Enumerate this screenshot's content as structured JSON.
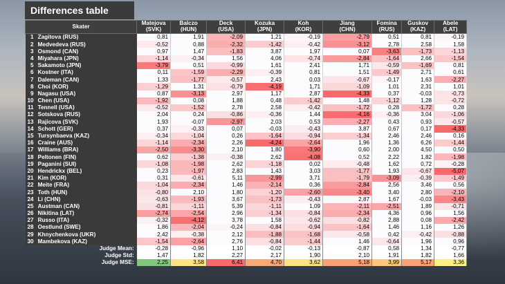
{
  "title": "Differences table",
  "chart_data": {
    "type": "table",
    "skater_header": "Skater",
    "judges": [
      "Matejova (SVK)",
      "Balczo (HUN)",
      "Deck (USA)",
      "Kozuka (JPN)",
      "Koh (KOR)",
      "Jiang (CHN)",
      "Fomina (RUS)",
      "Guskov (KAZ)",
      "Abele (LAT)"
    ],
    "rows": [
      {
        "rank": "1",
        "skater": "Zagitova (RUS)",
        "values": [
          "0,81",
          "1,91",
          "-2,09",
          "1,21",
          "-0,19",
          "-2,79",
          "0,51",
          "0,81",
          "-0,19"
        ]
      },
      {
        "rank": "2",
        "skater": "Medvedeva (RUS)",
        "values": [
          "-0,52",
          "0,88",
          "-2,32",
          "-1,42",
          "-0,42",
          "-3,12",
          "2,78",
          "2,58",
          "1,58"
        ]
      },
      {
        "rank": "3",
        "skater": "Osmond (CAN)",
        "values": [
          "0,97",
          "1,47",
          "-1,83",
          "3,87",
          "1,97",
          "0,07",
          "-3,63",
          "-1,73",
          "-1,13"
        ]
      },
      {
        "rank": "4",
        "skater": "Miyahara (JPN)",
        "values": [
          "-1,14",
          "-0,34",
          "1,56",
          "4,06",
          "-0,74",
          "-2,84",
          "-1,64",
          "2,66",
          "-1,54"
        ]
      },
      {
        "rank": "5",
        "skater": "Sakamoto (JPN)",
        "values": [
          "-3,79",
          "0,51",
          "-0,99",
          "1,61",
          "2,41",
          "1,71",
          "-0,59",
          "-1,69",
          "0,81"
        ]
      },
      {
        "rank": "6",
        "skater": "Kostner (ITA)",
        "values": [
          "0,11",
          "-1,59",
          "-2,29",
          "-0,39",
          "0,81",
          "1,51",
          "-1,49",
          "2,71",
          "0,61"
        ]
      },
      {
        "rank": "7",
        "skater": "Daleman (CAN)",
        "values": [
          "1,33",
          "-1,77",
          "-0,57",
          "2,43",
          "0,03",
          "-0,67",
          "-0,17",
          "1,63",
          "-2,27"
        ]
      },
      {
        "rank": "8",
        "skater": "Choi (KOR)",
        "values": [
          "-1,29",
          "1,31",
          "-0,79",
          "-4,19",
          "1,71",
          "-1,09",
          "1,01",
          "2,31",
          "1,01"
        ]
      },
      {
        "rank": "9",
        "skater": "Nagasu (USA)",
        "values": [
          "0,87",
          "-3,13",
          "2,97",
          "1,17",
          "2,87",
          "-4,33",
          "0,37",
          "-0,03",
          "-0,73"
        ]
      },
      {
        "rank": "10",
        "skater": "Chen (USA)",
        "values": [
          "-1,92",
          "0,08",
          "1,88",
          "0,48",
          "-1,42",
          "1,48",
          "-1,12",
          "1,28",
          "-0,72"
        ]
      },
      {
        "rank": "11",
        "skater": "Tennell (USA)",
        "values": [
          "-0,52",
          "-1,52",
          "2,78",
          "2,58",
          "-0,42",
          "-1,72",
          "0,28",
          "-1,72",
          "0,28"
        ]
      },
      {
        "rank": "12",
        "skater": "Sotskova (RUS)",
        "values": [
          "2,04",
          "0,24",
          "-0,86",
          "-0,36",
          "1,44",
          "-4,16",
          "-0,36",
          "3,04",
          "-1,06"
        ]
      },
      {
        "rank": "13",
        "skater": "Rajicova (SVK)",
        "values": [
          "1,93",
          "-0,07",
          "-2,97",
          "2,03",
          "0,53",
          "-2,27",
          "0,43",
          "0,93",
          "-0,57"
        ]
      },
      {
        "rank": "14",
        "skater": "Schott (GER)",
        "values": [
          "0,37",
          "-0,33",
          "0,07",
          "-0,03",
          "-0,43",
          "3,87",
          "0,67",
          "0,17",
          "-4,33"
        ]
      },
      {
        "rank": "15",
        "skater": "Tursynbaeva (KAZ)",
        "values": [
          "-0,34",
          "-1,04",
          "0,26",
          "-1,64",
          "-0,94",
          "-1,34",
          "2,46",
          "2,46",
          "0,16"
        ]
      },
      {
        "rank": "16",
        "skater": "Craine (AUS)",
        "values": [
          "-1,14",
          "-2,34",
          "2,26",
          "-4,24",
          "-2,64",
          "1,96",
          "1,36",
          "6,26",
          "-1,44"
        ]
      },
      {
        "rank": "17",
        "skater": "Williams (BRA)",
        "values": [
          "-2,50",
          "-3,30",
          "2,10",
          "1,80",
          "-3,90",
          "0,60",
          "2,00",
          "4,50",
          "0,50"
        ]
      },
      {
        "rank": "18",
        "skater": "Peltonen (FIN)",
        "values": [
          "0,62",
          "-1,38",
          "-0,38",
          "2,62",
          "-4,08",
          "0,52",
          "2,22",
          "1,82",
          "-1,98"
        ]
      },
      {
        "rank": "19",
        "skater": "Paganini (SUI)",
        "values": [
          "-1,08",
          "-1,98",
          "2,62",
          "-1,18",
          "0,02",
          "-0,48",
          "1,62",
          "0,72",
          "-0,28"
        ]
      },
      {
        "rank": "20",
        "skater": "Hendrickx (BEL)",
        "values": [
          "0,23",
          "-1,97",
          "2,83",
          "1,43",
          "3,03",
          "-1,77",
          "1,93",
          "-0,67",
          "-5,07"
        ]
      },
      {
        "rank": "21",
        "skater": "Kim (KOR)",
        "values": [
          "0,31",
          "-0,61",
          "5,11",
          "-2,99",
          "3,71",
          "-1,79",
          "-3,09",
          "-0,39",
          "-1,49"
        ]
      },
      {
        "rank": "22",
        "skater": "Meite (FRA)",
        "values": [
          "-1,04",
          "-2,34",
          "1,46",
          "-2,14",
          "0,36",
          "-2,84",
          "2,56",
          "3,46",
          "0,56"
        ]
      },
      {
        "rank": "23",
        "skater": "Toth (HUN)",
        "values": [
          "-0,80",
          "2,10",
          "1,80",
          "-1,20",
          "-2,60",
          "-3,40",
          "3,40",
          "2,80",
          "-2,10"
        ]
      },
      {
        "rank": "24",
        "skater": "Li (CHN)",
        "values": [
          "-0,63",
          "-1,93",
          "3,67",
          "-1,73",
          "-0,43",
          "2,87",
          "1,67",
          "-0,03",
          "-3,43"
        ]
      },
      {
        "rank": "25",
        "skater": "Austman (CAN)",
        "values": [
          "-0,81",
          "-1,11",
          "5,39",
          "-1,11",
          "1,09",
          "-2,11",
          "-2,51",
          "1,89",
          "-0,71"
        ]
      },
      {
        "rank": "26",
        "skater": "Nikitina (LAT)",
        "values": [
          "-2,74",
          "-2,54",
          "2,96",
          "-1,34",
          "-0,84",
          "-2,34",
          "4,36",
          "0,96",
          "1,56"
        ]
      },
      {
        "rank": "27",
        "skater": "Russo (ITA)",
        "values": [
          "-0,32",
          "-4,12",
          "3,78",
          "1,58",
          "-0,62",
          "-0,82",
          "2,88",
          "0,08",
          "-2,42"
        ]
      },
      {
        "rank": "28",
        "skater": "Oestlund (SWE)",
        "values": [
          "1,86",
          "-2,04",
          "-0,24",
          "-0,84",
          "-0,94",
          "-1,64",
          "1,46",
          "1,16",
          "1,26"
        ]
      },
      {
        "rank": "29",
        "skater": "Khnychenkova (UKR)",
        "values": [
          "2,42",
          "-0,38",
          "2,12",
          "-1,88",
          "-1,68",
          "-0,58",
          "0,42",
          "-0,42",
          "-0,88"
        ]
      },
      {
        "rank": "30",
        "skater": "Mambekova (KAZ)",
        "values": [
          "-1,54",
          "-2,64",
          "2,76",
          "-0,84",
          "-1,44",
          "1,46",
          "-0,64",
          "1,96",
          "0,96"
        ]
      }
    ],
    "summary": [
      {
        "label": "Judge Mean:",
        "values": [
          "-0,28",
          "-0,96",
          "1,10",
          "-0,02",
          "-0,13",
          "-0,87",
          "0,58",
          "1,34",
          "-0,77"
        ],
        "colors": []
      },
      {
        "label": "Judge Std:",
        "values": [
          "1,47",
          "1,82",
          "2,27",
          "2,17",
          "1,90",
          "2,10",
          "1,91",
          "1,82",
          "1,66"
        ],
        "colors": []
      },
      {
        "label": "Judge MSE:",
        "values": [
          "2,25",
          "3,58",
          "6,41",
          "4,70",
          "3,62",
          "5,18",
          "3,99",
          "5,17",
          "3,36"
        ],
        "colors": [
          "#82c77c",
          "#ffe480",
          "#f8696b",
          "#fba877",
          "#fee282",
          "#faa075",
          "#fdc87e",
          "#faa175",
          "#fef084"
        ]
      }
    ],
    "color_scale": {
      "low": "#f8696b",
      "mid": "#fcfcff",
      "high": "#fcfcff"
    }
  }
}
